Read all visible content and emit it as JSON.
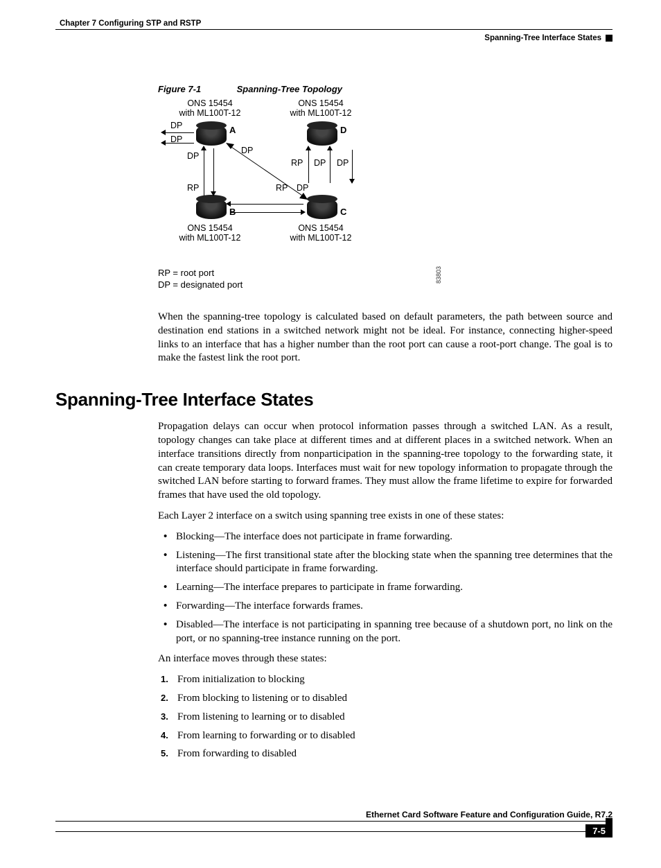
{
  "header": {
    "chapter": "Chapter 7    Configuring STP and RSTP",
    "section": "Spanning-Tree Interface States"
  },
  "figure": {
    "number": "Figure 7-1",
    "title": "Spanning-Tree Topology",
    "devices": {
      "A": {
        "label_top": "ONS 15454",
        "label_bottom": "with ML100T-12",
        "letter": "A"
      },
      "B": {
        "label_top": "ONS 15454",
        "label_bottom": "with ML100T-12",
        "letter": "B"
      },
      "C": {
        "label_top": "ONS 15454",
        "label_bottom": "with ML100T-12",
        "letter": "C"
      },
      "D": {
        "label_top": "ONS 15454",
        "label_bottom": "with ML100T-12",
        "letter": "D"
      }
    },
    "port_labels": {
      "a_left_top": "DP",
      "a_left_bottom": "DP",
      "a_down": "DP",
      "a_diag": "DP",
      "b_up": "RP",
      "b_right": "RP",
      "c_left": "DP",
      "d_left_rp": "RP",
      "d_mid_dp": "DP",
      "d_right_dp": "DP"
    },
    "legend": {
      "rp": "RP = root port",
      "dp": "DP = designated port"
    },
    "id": "83803"
  },
  "paragraphs": {
    "after_figure": "When the spanning-tree topology is calculated based on default parameters, the path between source and destination end stations in a switched network might not be ideal. For instance, connecting higher-speed links to an interface that has a higher number than the root port can cause a root-port change. The goal is to make the fastest link the root port.",
    "section_intro": "Propagation delays can occur when protocol information passes through a switched LAN. As a result, topology changes can take place at different times and at different places in a switched network. When an interface transitions directly from nonparticipation in the spanning-tree topology to the forwarding state, it can create temporary data loops. Interfaces must wait for new topology information to propagate through the switched LAN before starting to forward frames. They must allow the frame lifetime to expire for forwarded frames that have used the old topology.",
    "states_lead": "Each Layer 2 interface on a switch using spanning tree exists in one of these states:",
    "transitions_lead": "An interface moves through these states:"
  },
  "section_heading": "Spanning-Tree Interface States",
  "states": [
    "Blocking—The interface does not participate in frame forwarding.",
    "Listening—The first transitional state after the blocking state when the spanning tree determines that the interface should participate in frame forwarding.",
    "Learning—The interface prepares to participate in frame forwarding.",
    "Forwarding—The interface forwards frames.",
    "Disabled—The interface is not participating in spanning tree because of a shutdown port, no link on the port, or no spanning-tree instance running on the port."
  ],
  "transitions": [
    "From initialization to blocking",
    "From blocking to listening or to disabled",
    "From listening to learning or to disabled",
    "From learning to forwarding or to disabled",
    "From forwarding to disabled"
  ],
  "footer": {
    "guide": "Ethernet Card Software Feature and Configuration Guide, R7.2",
    "page": "7-5"
  }
}
